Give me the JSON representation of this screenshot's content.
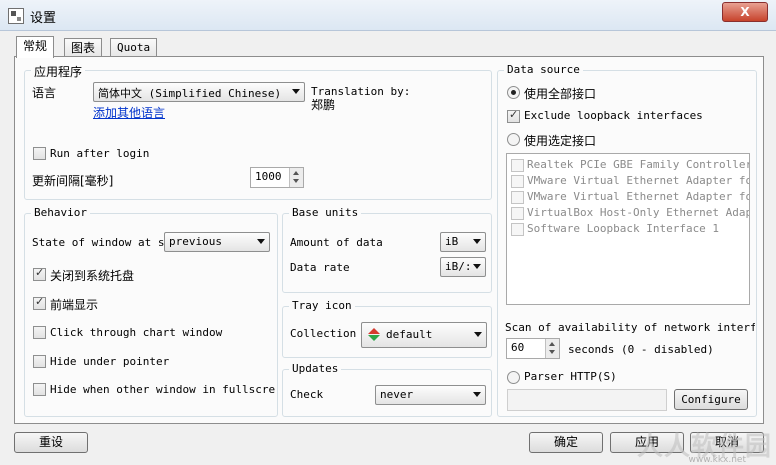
{
  "window": {
    "title": "设置",
    "close_label": "X"
  },
  "tabs": [
    {
      "label": "常规"
    },
    {
      "label": "图表"
    },
    {
      "label": "Quota"
    }
  ],
  "app": {
    "title": "应用程序",
    "language_label": "语言",
    "language_value": "简体中文 (Simplified Chinese)",
    "translation_by_label": "Translation by:",
    "translator": "郑鹏",
    "add_language_link": "添加其他语言",
    "run_after_login": "Run after login",
    "update_interval_label": "更新间隔[毫秒]",
    "update_interval_value": "1000"
  },
  "behavior": {
    "title": "Behavior",
    "state_label": "State of window at sta",
    "state_value": "previous",
    "close_to_tray": "关闭到系统托盘",
    "always_on_top": "前端显示",
    "click_through": "Click through chart window",
    "hide_under_pointer": "Hide under pointer",
    "hide_fullscreen": "Hide when other window in fullscreen m"
  },
  "base_units": {
    "title": "Base units",
    "amount_label": "Amount of data",
    "amount_value": "iB",
    "rate_label": "Data rate",
    "rate_value": "iB/:"
  },
  "tray_icon": {
    "title": "Tray icon",
    "collection_label": "Collection",
    "collection_value": "default"
  },
  "updates": {
    "title": "Updates",
    "check_label": "Check",
    "check_value": "never"
  },
  "data_source": {
    "title": "Data source",
    "all_interfaces": "使用全部接口",
    "exclude_loopback": "Exclude loopback interfaces",
    "selected_interfaces": "使用选定接口",
    "adapters": [
      "Realtek PCIe GBE Family Controller",
      "VMware Virtual Ethernet Adapter for V",
      "VMware Virtual Ethernet Adapter for V",
      "VirtualBox Host-Only Ethernet Adapter",
      "Software Loopback Interface 1"
    ],
    "scan_label": "Scan of availability of network interfaces",
    "scan_value": "60",
    "scan_unit": "seconds (0 - disabled)",
    "parser_http": "Parser HTTP(S)",
    "configure_label": "Configure"
  },
  "footer": {
    "reset": "重设",
    "ok": "确定",
    "apply": "应用",
    "cancel": "取消"
  },
  "watermark": {
    "text": "人人软件园",
    "url": "www.kkx.net"
  }
}
